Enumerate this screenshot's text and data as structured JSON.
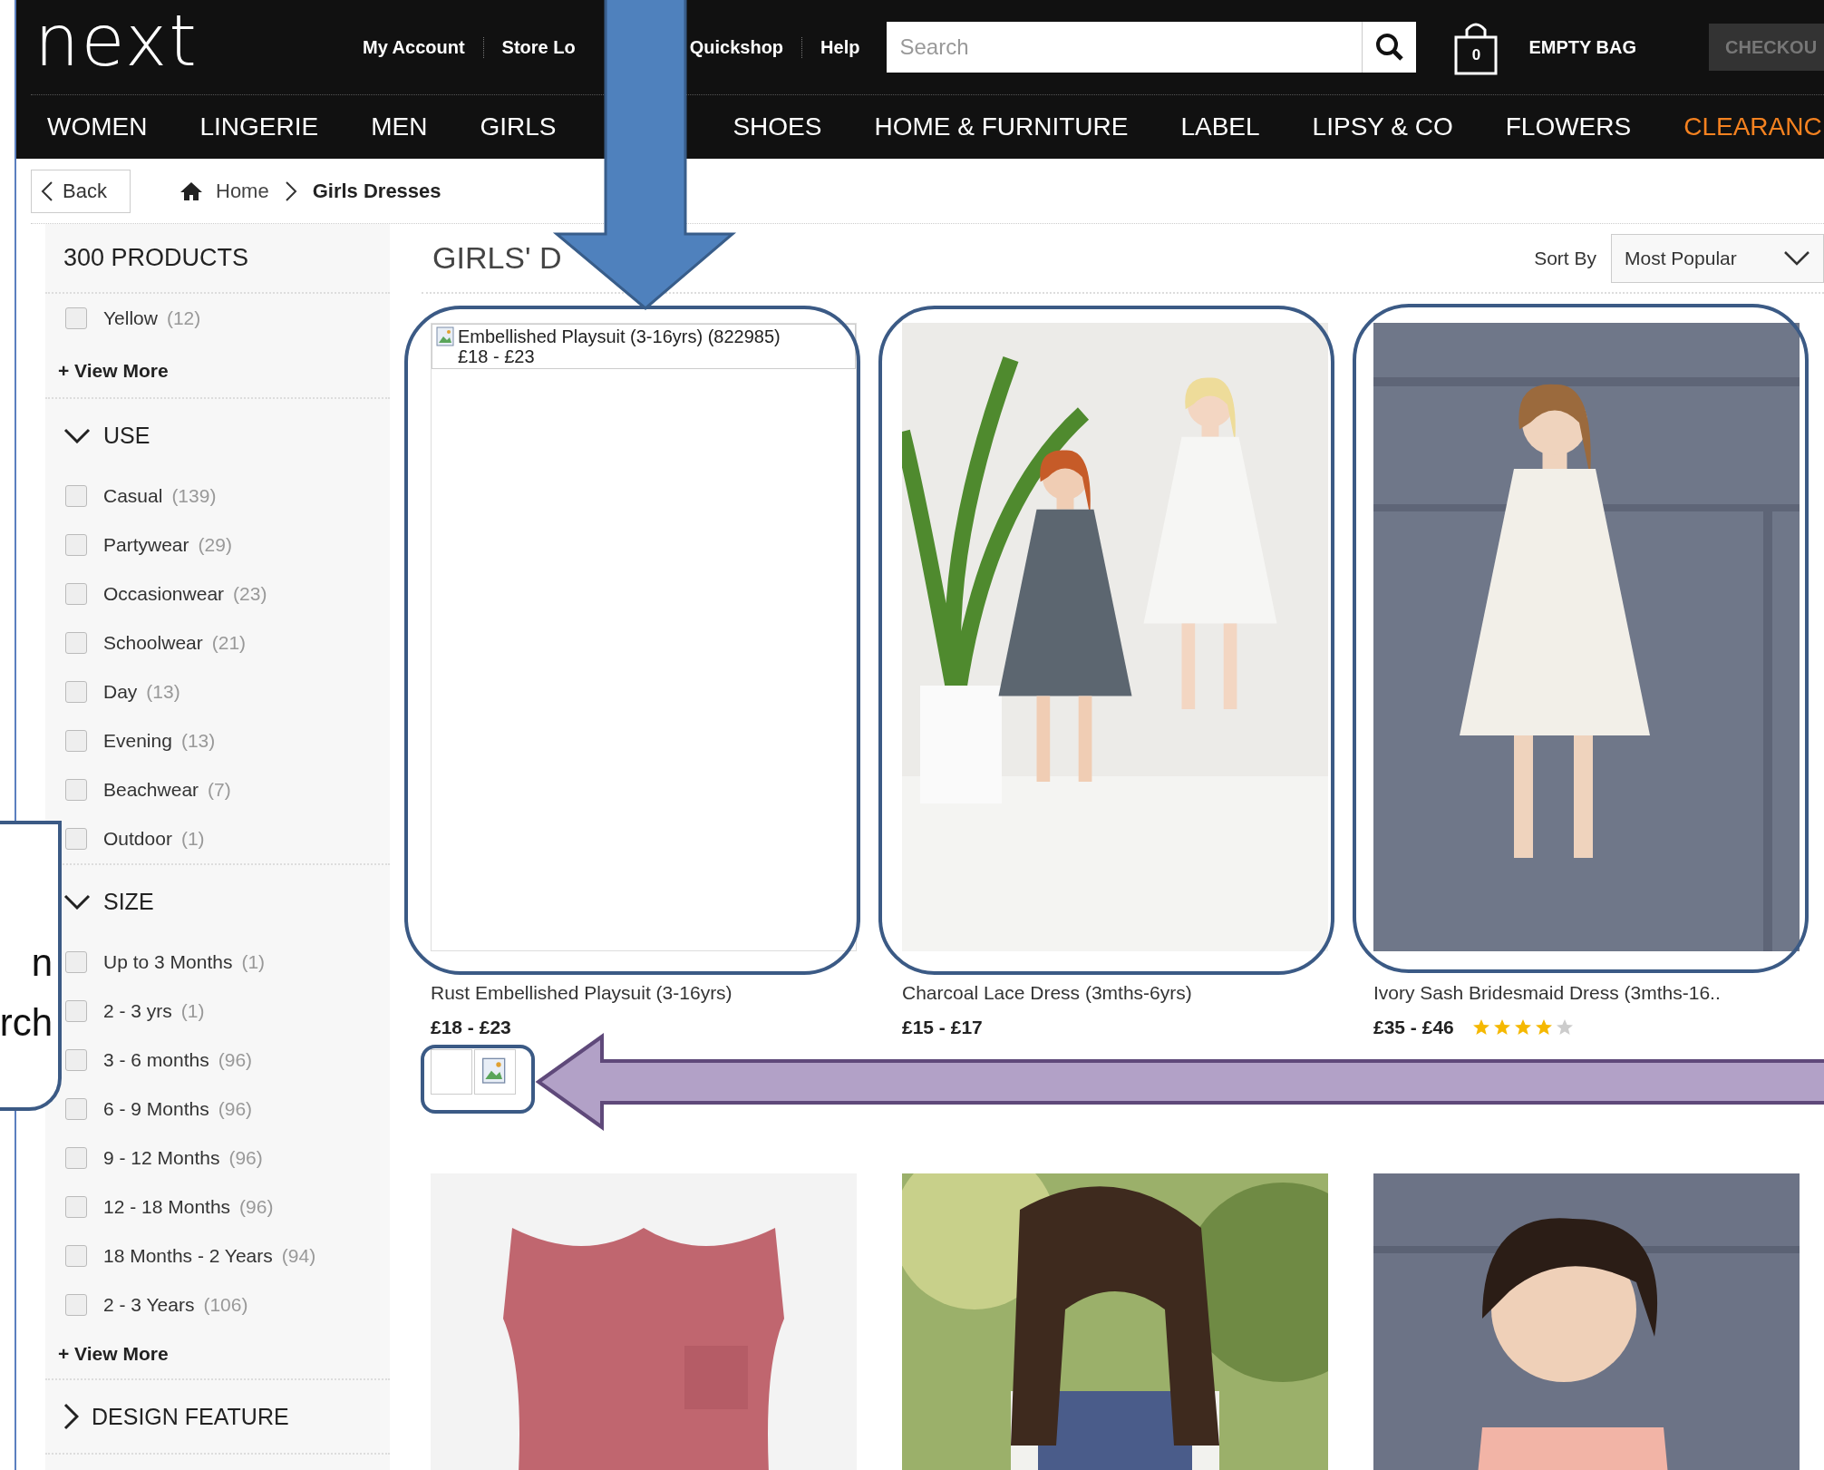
{
  "header": {
    "logo": "next",
    "links_left": [
      "My Account",
      "Store Lo"
    ],
    "links_right": [
      "Quickshop",
      "Help"
    ],
    "search": {
      "placeholder": "Search"
    },
    "bag": {
      "count": "0",
      "label": "EMPTY BAG"
    },
    "checkout": "CHECKOU"
  },
  "nav": {
    "left": [
      {
        "label": "WOMEN",
        "highlight": false
      },
      {
        "label": "LINGERIE",
        "highlight": false
      },
      {
        "label": "MEN",
        "highlight": false
      },
      {
        "label": "GIRLS",
        "highlight": false
      }
    ],
    "right": [
      {
        "label": "SHOES",
        "highlight": false
      },
      {
        "label": "HOME & FURNITURE",
        "highlight": false
      },
      {
        "label": "LABEL",
        "highlight": false
      },
      {
        "label": "LIPSY & CO",
        "highlight": false
      },
      {
        "label": "FLOWERS",
        "highlight": false
      },
      {
        "label": "CLEARANC",
        "highlight": true
      }
    ]
  },
  "breadcrumb": {
    "back": "Back",
    "items": [
      "Home",
      "Girls Dresses"
    ]
  },
  "sidebar": {
    "count": "300 PRODUCTS",
    "top_options": [
      {
        "label": "Yellow",
        "count": "(12)",
        "checked": false
      }
    ],
    "top_view_more": "+ View More",
    "sections": [
      {
        "title": "USE",
        "expanded": true,
        "options": [
          {
            "label": "Casual",
            "count": "(139)",
            "checked": false
          },
          {
            "label": "Partywear",
            "count": "(29)",
            "checked": false
          },
          {
            "label": "Occasionwear",
            "count": "(23)",
            "checked": false
          },
          {
            "label": "Schoolwear",
            "count": "(21)",
            "checked": false
          },
          {
            "label": "Day",
            "count": "(13)",
            "checked": false
          },
          {
            "label": "Evening",
            "count": "(13)",
            "checked": false
          },
          {
            "label": "Beachwear",
            "count": "(7)",
            "checked": false
          },
          {
            "label": "Outdoor",
            "count": "(1)",
            "checked": false
          }
        ]
      },
      {
        "title": "SIZE",
        "expanded": true,
        "view_more": "+ View More",
        "options": [
          {
            "label": "Up to 3 Months",
            "count": "(1)",
            "checked": false
          },
          {
            "label": "2 - 3 yrs",
            "count": "(1)",
            "checked": false
          },
          {
            "label": "3 - 6 months",
            "count": "(96)",
            "checked": false
          },
          {
            "label": "6 - 9 Months",
            "count": "(96)",
            "checked": false
          },
          {
            "label": "9 - 12 Months",
            "count": "(96)",
            "checked": false
          },
          {
            "label": "12 - 18 Months",
            "count": "(96)",
            "checked": false
          },
          {
            "label": "18 Months - 2 Years",
            "count": "(94)",
            "checked": false
          },
          {
            "label": "2 - 3 Years",
            "count": "(106)",
            "checked": false
          }
        ]
      },
      {
        "title": "DESIGN FEATURE",
        "expanded": false
      }
    ]
  },
  "main": {
    "title": "GIRLS' D",
    "sort": {
      "label": "Sort By",
      "value": "Most Popular"
    },
    "products": [
      {
        "kind": "broken",
        "alt_lines": [
          "Embellished Playsuit (3-16yrs) (822985)",
          "£18 - £23"
        ],
        "name": "Rust Embellished Playsuit (3-16yrs)",
        "price": "£18 - £23",
        "swatches": [
          {
            "kind": "blank"
          },
          {
            "kind": "broken"
          }
        ]
      },
      {
        "kind": "picture",
        "name": "Charcoal Lace Dress (3mths-6yrs)",
        "price": "£15 - £17"
      },
      {
        "kind": "picture",
        "name": "Ivory Sash Bridesmaid Dress (3mths-16..",
        "price": "£35 - £46",
        "stars": 4
      },
      {
        "kind": "picture"
      },
      {
        "kind": "picture"
      },
      {
        "kind": "picture"
      }
    ]
  },
  "annotations": {
    "callout": {
      "lines": [
        "n",
        "rch"
      ]
    }
  }
}
